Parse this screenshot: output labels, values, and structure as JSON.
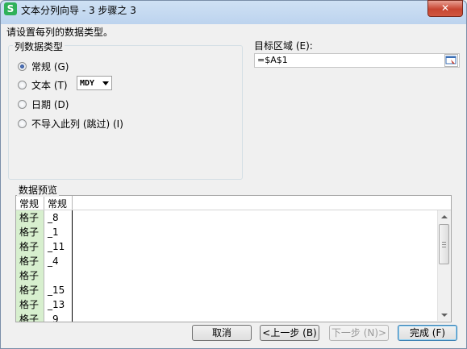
{
  "window": {
    "title": "文本分列向导 - 3 步骤之 3",
    "app_icon_letter": "S",
    "close_glyph": "✕"
  },
  "prompt": "请设置每列的数据类型。",
  "column_type_group": {
    "legend": "列数据类型",
    "options": [
      {
        "label": "常规 (G)",
        "checked": true
      },
      {
        "label": "文本 (T)",
        "checked": false
      },
      {
        "label": "日期 (D)",
        "checked": false
      },
      {
        "label": "不导入此列 (跳过) (I)",
        "checked": false
      }
    ],
    "date_format": "MDY"
  },
  "target": {
    "label": "目标区域 (E):",
    "value": "=$A$1"
  },
  "preview": {
    "label": "数据预览",
    "headers": [
      "常规",
      "常规"
    ],
    "rows": [
      [
        "格子",
        "_8"
      ],
      [
        "格子",
        "_1"
      ],
      [
        "格子",
        "_11"
      ],
      [
        "格子",
        "_4"
      ],
      [
        "格子",
        ""
      ],
      [
        "格子",
        "_15"
      ],
      [
        "格子",
        "_13"
      ],
      [
        "格子",
        "_9"
      ]
    ]
  },
  "buttons": {
    "cancel": "取消",
    "back": "<上一步 (B)",
    "next": "下一步 (N)>",
    "finish": "完成 (F)"
  },
  "colors": {
    "column_highlight": "#d7efce",
    "app_icon": "#2fb159"
  }
}
